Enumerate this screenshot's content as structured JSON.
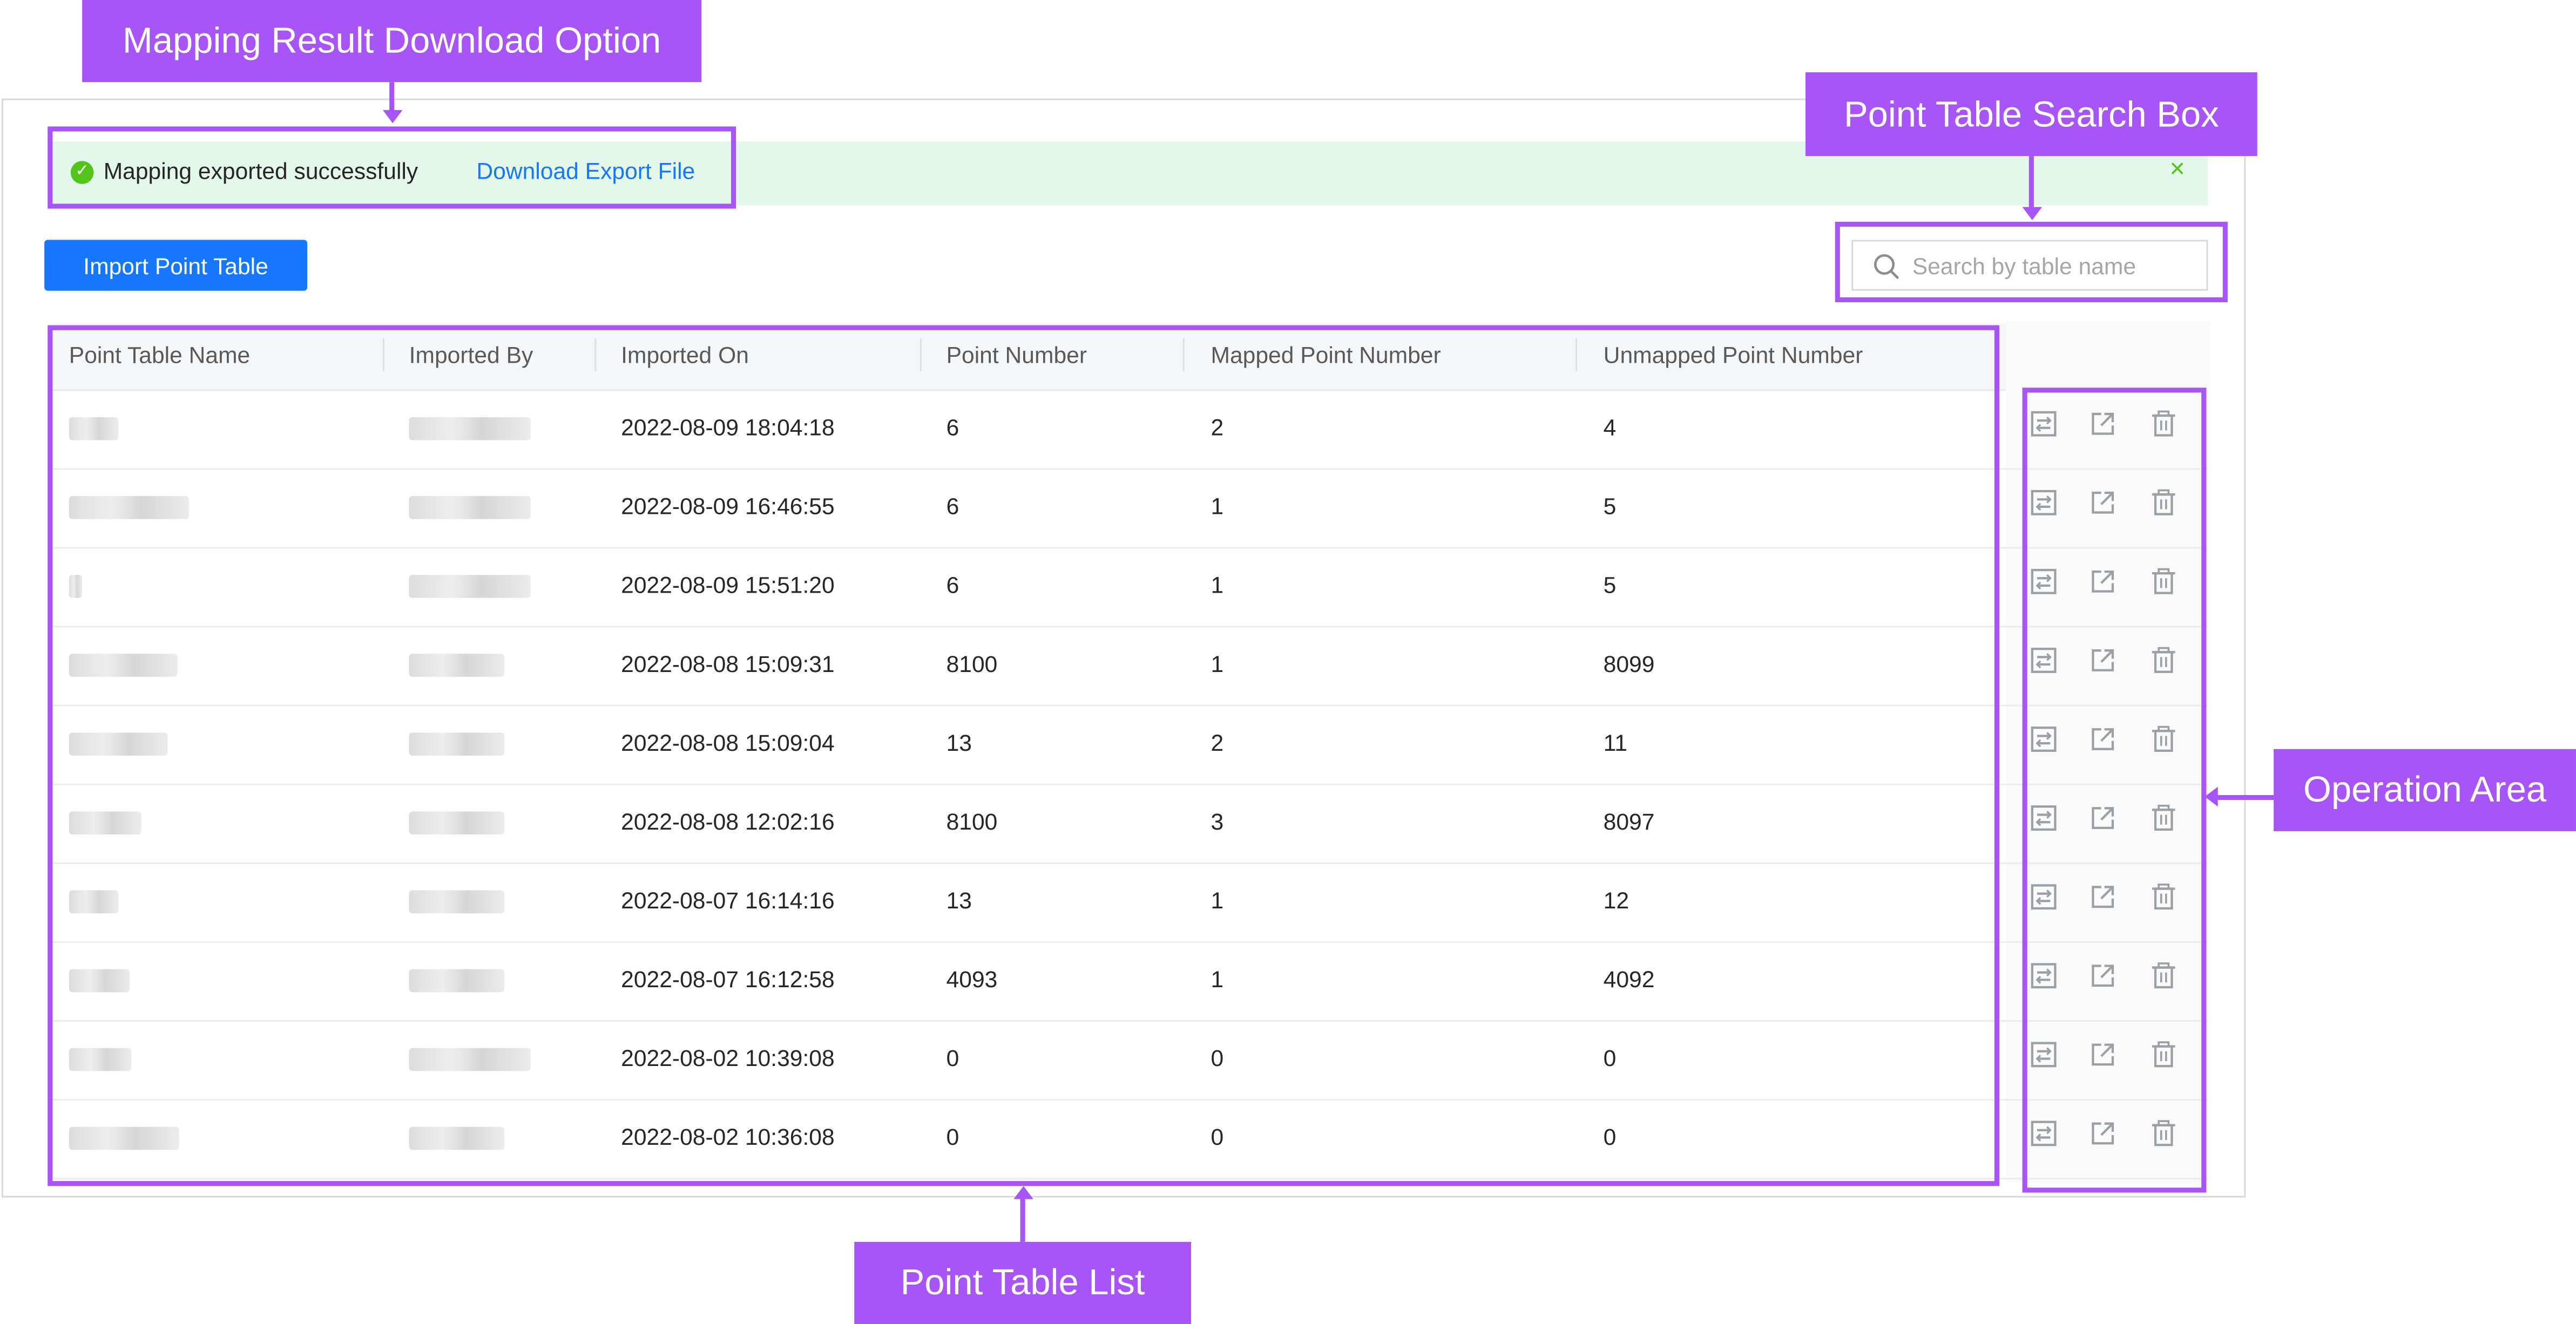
{
  "banner": {
    "message": "Mapping exported successfully",
    "link": "Download Export File",
    "close": "×"
  },
  "toolbar": {
    "import_label": "Import Point Table",
    "search_placeholder": "Search by table name"
  },
  "table": {
    "columns": [
      "Point Table Name",
      "Imported By",
      "Imported On",
      "Point Number",
      "Mapped Point Number",
      "Unmapped Point Number"
    ],
    "rows": [
      {
        "imported_on": "2022-08-09 18:04:18",
        "points": "6",
        "mapped": "2",
        "unmapped": "4"
      },
      {
        "imported_on": "2022-08-09 16:46:55",
        "points": "6",
        "mapped": "1",
        "unmapped": "5"
      },
      {
        "imported_on": "2022-08-09 15:51:20",
        "points": "6",
        "mapped": "1",
        "unmapped": "5"
      },
      {
        "imported_on": "2022-08-08 15:09:31",
        "points": "8100",
        "mapped": "1",
        "unmapped": "8099"
      },
      {
        "imported_on": "2022-08-08 15:09:04",
        "points": "13",
        "mapped": "2",
        "unmapped": "11"
      },
      {
        "imported_on": "2022-08-08 12:02:16",
        "points": "8100",
        "mapped": "3",
        "unmapped": "8097"
      },
      {
        "imported_on": "2022-08-07 16:14:16",
        "points": "13",
        "mapped": "1",
        "unmapped": "12"
      },
      {
        "imported_on": "2022-08-07 16:12:58",
        "points": "4093",
        "mapped": "1",
        "unmapped": "4092"
      },
      {
        "imported_on": "2022-08-02 10:39:08",
        "points": "0",
        "mapped": "0",
        "unmapped": "0"
      },
      {
        "imported_on": "2022-08-02 10:36:08",
        "points": "0",
        "mapped": "0",
        "unmapped": "0"
      }
    ]
  },
  "annotations": {
    "download": "Mapping Result Download Option",
    "search": "Point Table Search Box",
    "operation": "Operation Area",
    "list": "Point Table List"
  },
  "colors": {
    "accent": "#1677ff",
    "success": "#52c41a",
    "annotation": "#a855f7"
  }
}
